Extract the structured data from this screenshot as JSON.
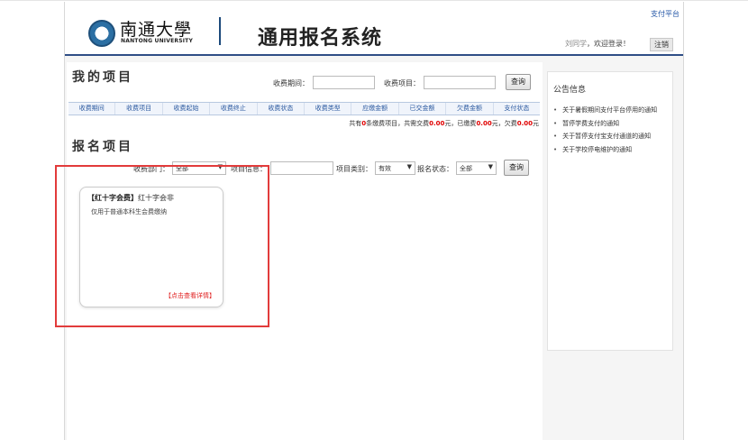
{
  "header": {
    "logo_cn": "南通大學",
    "logo_en": "NANTONG UNIVERSITY",
    "system_title": "通用报名系统",
    "pay_platform_link": "支付平台",
    "user_name": "刘同学",
    "welcome_text": "，欢迎登录！",
    "logout_label": "注销"
  },
  "my_projects": {
    "title": "我的项目",
    "period_label": "收费期间：",
    "item_label": "收费项目：",
    "query_label": "查询",
    "columns": [
      "收费期间",
      "收费项目",
      "收费起始",
      "收费终止",
      "收费状态",
      "收费类型",
      "应缴金额",
      "已交金额",
      "欠费金额",
      "支付状态"
    ],
    "summary": {
      "prefix": "共有",
      "count": "0",
      "mid1": "条缴费项目，共需交费",
      "total": "0.00",
      "mid2": "元，已缴费",
      "paid": "0.00",
      "mid3": "元，欠费",
      "owed": "0.00",
      "suffix": "元"
    }
  },
  "registration": {
    "title": "报名项目",
    "dept_label": "收费部门：",
    "dept_value": "全部",
    "info_label": "项目信息：",
    "category_label": "项目类别：",
    "category_value": "有效",
    "status_label": "报名状态：",
    "status_value": "全部",
    "query_label": "查询"
  },
  "cards": [
    {
      "tag": "【红十字会费】",
      "org": "红十字会非",
      "desc": "仅用于普通本科生会费缴纳",
      "more": "【点击查看详情】"
    }
  ],
  "notice": {
    "title": "公告信息",
    "items": [
      "关于暑假期间支付平台停用的通知",
      "暂停学费支付的通知",
      "关于暂停支付宝支付通道的通知",
      "关于学校停电维护的通知"
    ]
  },
  "colors": {
    "accent": "#2f4e86",
    "alert": "#e23b3b"
  }
}
